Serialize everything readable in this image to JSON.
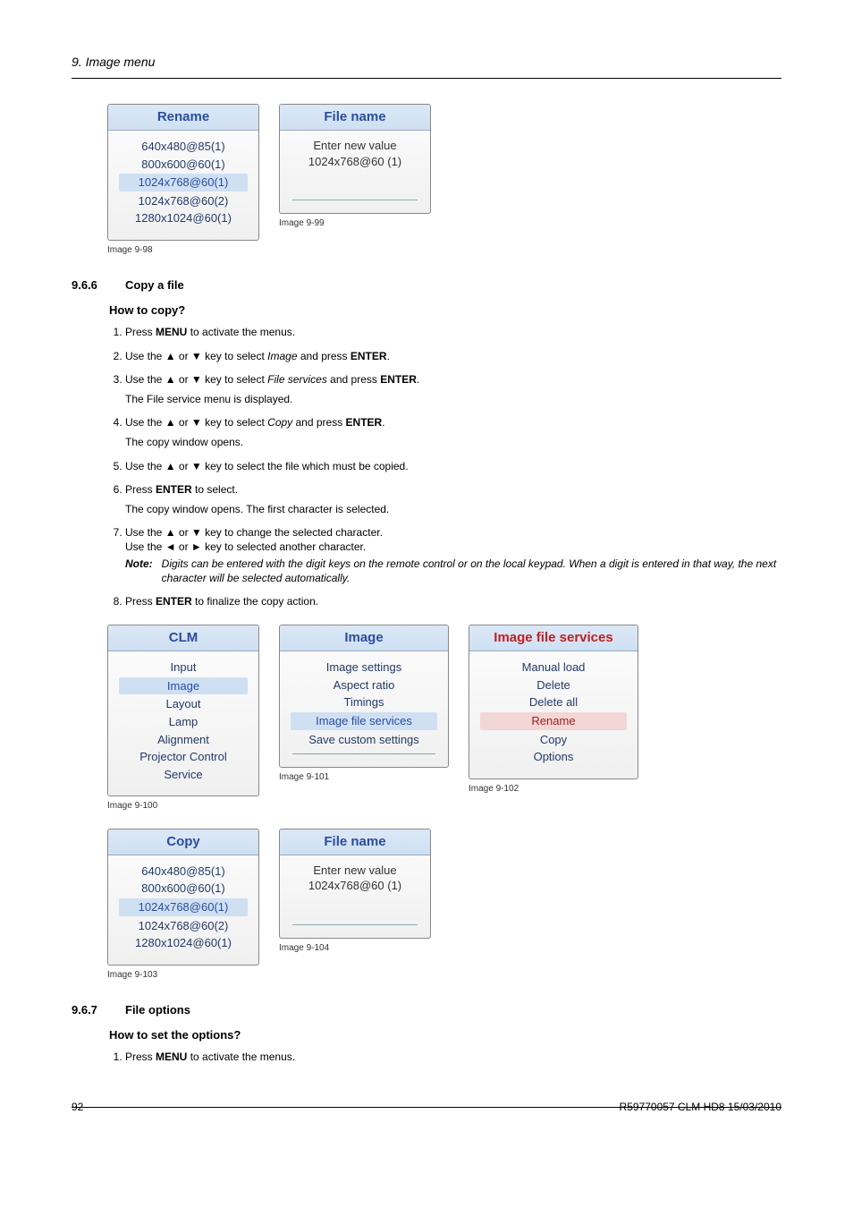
{
  "chapter_header": "9.  Image menu",
  "fig_rename": {
    "title": "Rename",
    "items": [
      "640x480@85(1)",
      "800x600@60(1)",
      "1024x768@60(1)",
      "1024x768@60(2)",
      "1280x1024@60(1)"
    ],
    "hl_index": 2,
    "caption": "Image 9-98"
  },
  "fig_filename1": {
    "title": "File name",
    "lines": [
      "Enter new value",
      "1024x768@60 (1)"
    ],
    "caption": "Image 9-99"
  },
  "section_966": {
    "num": "9.6.6",
    "title": "Copy a file"
  },
  "how_to_copy_heading": "How to copy?",
  "steps_copy": [
    {
      "pre": "Press ",
      "b1": "MENU",
      "post": " to activate the menus."
    },
    {
      "pre": "Use the ▲ or ▼ key to select ",
      "i": "Image",
      "mid": " and press ",
      "b1": "ENTER",
      "post": "."
    },
    {
      "pre": "Use the ▲ or ▼ key to select ",
      "i": "File services",
      "mid": " and press ",
      "b1": "ENTER",
      "post": ".",
      "sub": "The File service menu is displayed."
    },
    {
      "pre": "Use the ▲ or ▼ key to select ",
      "i": "Copy",
      "mid": " and press ",
      "b1": "ENTER",
      "post": ".",
      "sub": "The copy window opens."
    },
    {
      "plain": "Use the ▲ or ▼ key to select the file which must be copied."
    },
    {
      "pre": "Press ",
      "b1": "ENTER",
      "post": " to select.",
      "sub": "The copy window opens.  The first character is selected."
    },
    {
      "plain": "Use the ▲ or ▼ key to change the selected character.",
      "line2": "Use the ◄ or ► key to selected another character.",
      "note_label": "Note:",
      "note": "Digits can be entered with the digit keys on the remote control or on the local keypad.  When a digit is entered in that way, the next character will be selected automatically."
    },
    {
      "pre": "Press ",
      "b1": "ENTER",
      "post": " to finalize the copy action."
    }
  ],
  "fig_clm": {
    "title": "CLM",
    "items": [
      "Input",
      "Image",
      "Layout",
      "Lamp",
      "Alignment",
      "Projector Control",
      "Service"
    ],
    "hl_index": 1,
    "caption": "Image 9-100"
  },
  "fig_image": {
    "title": "Image",
    "items": [
      "Image settings",
      "Aspect ratio",
      "Timings",
      "Image file services",
      "Save custom settings"
    ],
    "hl_index": 3,
    "caption": "Image 9-101"
  },
  "fig_services": {
    "title": "Image file services",
    "items": [
      "Manual load",
      "Delete",
      "Delete all",
      "Rename",
      "Copy",
      "Options"
    ],
    "hl_index": 3,
    "red": true,
    "caption": "Image 9-102"
  },
  "fig_copy": {
    "title": "Copy",
    "items": [
      "640x480@85(1)",
      "800x600@60(1)",
      "1024x768@60(1)",
      "1024x768@60(2)",
      "1280x1024@60(1)"
    ],
    "hl_index": 2,
    "caption": "Image 9-103"
  },
  "fig_filename2": {
    "title": "File name",
    "lines": [
      "Enter new value",
      "1024x768@60 (1)"
    ],
    "caption": "Image 9-104"
  },
  "section_967": {
    "num": "9.6.7",
    "title": "File options"
  },
  "how_to_options_heading": "How to set the options?",
  "steps_options": [
    {
      "pre": "Press ",
      "b1": "MENU",
      "post": " to activate the menus."
    }
  ],
  "footer": {
    "page": "92",
    "doc": "R59770057 CLM HD8  15/03/2010"
  }
}
